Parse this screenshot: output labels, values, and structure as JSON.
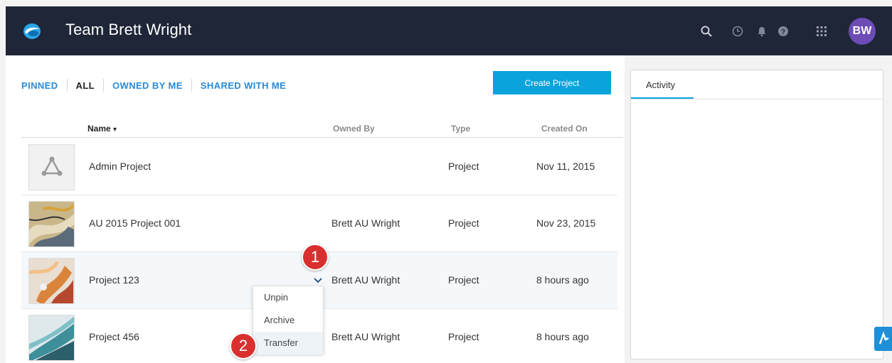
{
  "header": {
    "team_title": "Team Brett Wright",
    "icons": [
      "search-icon",
      "clock-icon",
      "bell-icon",
      "help-icon",
      "apps-grid-icon"
    ],
    "avatar_initials": "BW"
  },
  "filters": [
    {
      "label": "PINNED",
      "active": false
    },
    {
      "label": "ALL",
      "active": true
    },
    {
      "label": "OWNED BY ME",
      "active": false
    },
    {
      "label": "SHARED WITH ME",
      "active": false
    }
  ],
  "create_button": "Create Project",
  "table": {
    "columns": {
      "name": "Name",
      "owned_by": "Owned By",
      "type": "Type",
      "created_on": "Created On"
    },
    "sort_indicator": "▾",
    "rows": [
      {
        "name": "Admin Project",
        "owned_by": "",
        "type": "Project",
        "created_on": "Nov 11, 2015"
      },
      {
        "name": "AU 2015 Project 001",
        "owned_by": "Brett AU Wright",
        "type": "Project",
        "created_on": "Nov 23, 2015"
      },
      {
        "name": "Project 123",
        "owned_by": "Brett AU Wright",
        "type": "Project",
        "created_on": "8 hours ago"
      },
      {
        "name": "Project 456",
        "owned_by": "Brett AU Wright",
        "type": "Project",
        "created_on": "8 hours ago"
      }
    ]
  },
  "row_menu": {
    "items": [
      "Unpin",
      "Archive",
      "Transfer"
    ]
  },
  "callouts": [
    "1",
    "2"
  ],
  "activity": {
    "tab_label": "Activity"
  },
  "colors": {
    "topbar": "#1f2638",
    "accent": "#0aa3dc",
    "link": "#2a8ad6",
    "avatar": "#6e4cb8",
    "callout": "#d9302f"
  }
}
